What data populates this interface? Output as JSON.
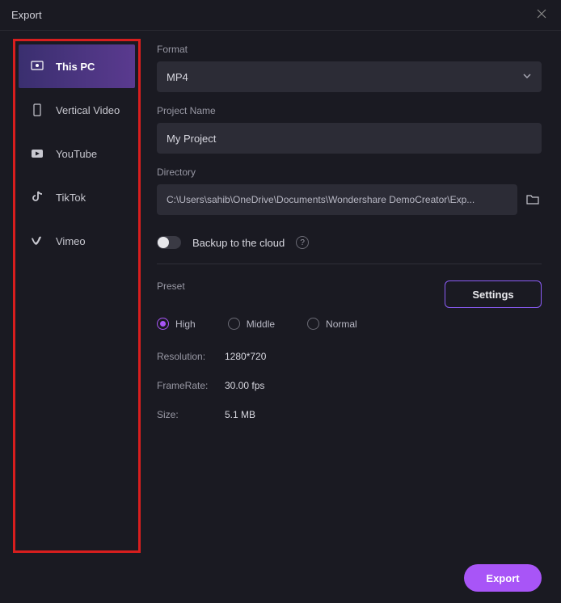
{
  "window": {
    "title": "Export"
  },
  "sidebar": {
    "items": [
      {
        "label": "This PC",
        "icon": "pc-icon"
      },
      {
        "label": "Vertical Video",
        "icon": "phone-icon"
      },
      {
        "label": "YouTube",
        "icon": "youtube-icon"
      },
      {
        "label": "TikTok",
        "icon": "tiktok-icon"
      },
      {
        "label": "Vimeo",
        "icon": "vimeo-icon"
      }
    ]
  },
  "main": {
    "format_label": "Format",
    "format_value": "MP4",
    "project_name_label": "Project Name",
    "project_name_value": "My Project",
    "directory_label": "Directory",
    "directory_value": "C:\\Users\\sahib\\OneDrive\\Documents\\Wondershare DemoCreator\\Exp...",
    "backup_label": "Backup to the cloud",
    "preset_label": "Preset",
    "settings_label": "Settings",
    "preset_options": [
      {
        "label": "High",
        "checked": true
      },
      {
        "label": "Middle",
        "checked": false
      },
      {
        "label": "Normal",
        "checked": false
      }
    ],
    "specs": {
      "resolution_label": "Resolution:",
      "resolution_value": "1280*720",
      "framerate_label": "FrameRate:",
      "framerate_value": "30.00 fps",
      "size_label": "Size:",
      "size_value": "5.1 MB"
    }
  },
  "footer": {
    "export_label": "Export"
  }
}
